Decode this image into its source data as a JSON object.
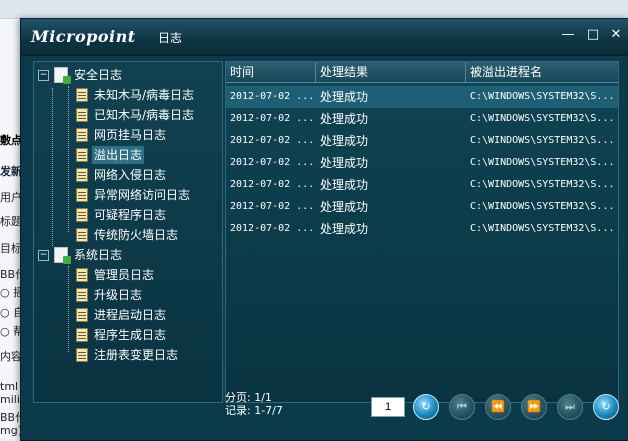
{
  "window": {
    "logo": "Micropoint",
    "title": "日志",
    "controls": {
      "minimize": "—",
      "maximize": "□",
      "close": "✕"
    }
  },
  "tree": {
    "groups": [
      {
        "label": "安全日志",
        "expanded": true,
        "items": [
          "未知木马/病毒日志",
          "已知木马/病毒日志",
          "网页挂马日志",
          "溢出日志",
          "网络入侵日志",
          "异常网络访问日志",
          "可疑程序日志",
          "传统防火墙日志"
        ],
        "selected_index": 3
      },
      {
        "label": "系统日志",
        "expanded": true,
        "items": [
          "管理员日志",
          "升级日志",
          "进程启动日志",
          "程序生成日志",
          "注册表变更日志"
        ]
      }
    ]
  },
  "list": {
    "columns": [
      "时间",
      "处理结果",
      "被溢出进程名"
    ],
    "rows": [
      [
        "2012-07-02 ...",
        "处理成功",
        "C:\\WINDOWS\\SYSTEM32\\S..."
      ],
      [
        "2012-07-02 ...",
        "处理成功",
        "C:\\WINDOWS\\SYSTEM32\\S..."
      ],
      [
        "2012-07-02 ...",
        "处理成功",
        "C:\\WINDOWS\\SYSTEM32\\S..."
      ],
      [
        "2012-07-02 ...",
        "处理成功",
        "C:\\WINDOWS\\SYSTEM32\\S..."
      ],
      [
        "2012-07-02 ...",
        "处理成功",
        "C:\\WINDOWS\\SYSTEM32\\S..."
      ],
      [
        "2012-07-02 ...",
        "处理成功",
        "C:\\WINDOWS\\SYSTEM32\\S..."
      ],
      [
        "2012-07-02 ...",
        "处理成功",
        "C:\\WINDOWS\\SYSTEM32\\S..."
      ]
    ],
    "selected_row": 0
  },
  "pager": {
    "pages": "分页: 1/1",
    "records": "记录: 1-7/7",
    "page_value": "1",
    "buttons": {
      "go": "↻",
      "first": "⏮",
      "prev": "⏪",
      "next": "⏩",
      "last": "⏭",
      "refresh": "↻"
    }
  },
  "background": {
    "labels": [
      "敷点",
      "发新",
      "用户:",
      "标题:",
      "目标",
      "BB代",
      "○ 摇",
      "○ 自",
      "○ 帮",
      "内容",
      "tml 划",
      "milie",
      "BB代",
      "mg]"
    ]
  }
}
